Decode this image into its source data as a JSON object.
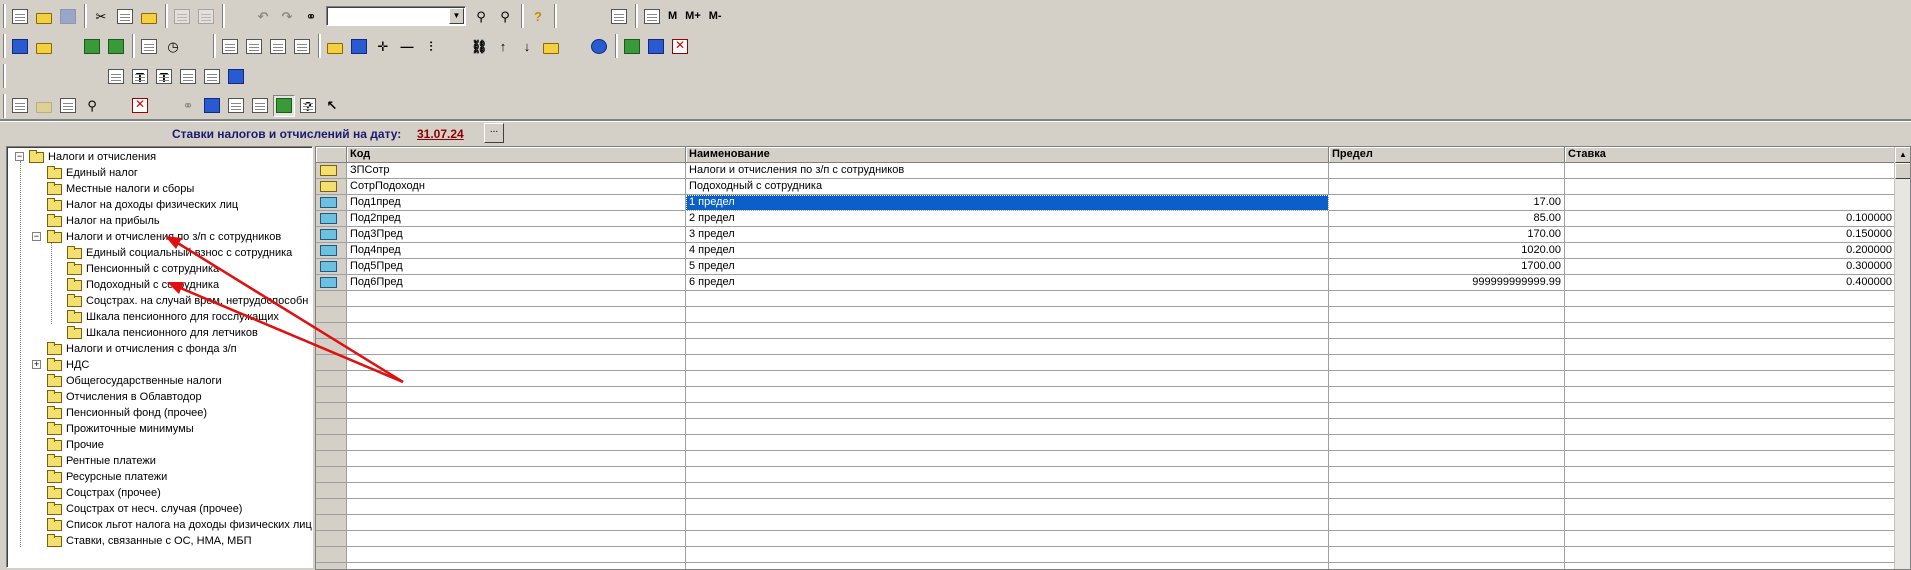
{
  "toolbar1": {
    "combo_value": "",
    "memory_labels": [
      "M",
      "M+",
      "M-"
    ]
  },
  "date_bar": {
    "label": "Ставки налогов и отчислений на дату:",
    "date": "31.07.24",
    "button": "..."
  },
  "tree": {
    "items": [
      {
        "label": "Налоги и отчисления"
      },
      {
        "label": "Единый налог"
      },
      {
        "label": "Местные налоги и сборы"
      },
      {
        "label": "Налог на доходы физических лиц"
      },
      {
        "label": "Налог на прибыль"
      },
      {
        "label": "Налоги и отчисления по з/п с сотрудников"
      },
      {
        "label": "Единый социальный взнос с сотрудника"
      },
      {
        "label": "Пенсионный с сотрудника"
      },
      {
        "label": "Подоходный с сотрудника"
      },
      {
        "label": "Соцстрах. на случай врем. нетрудоспособн"
      },
      {
        "label": "Шкала пенсионного для госслужащих"
      },
      {
        "label": "Шкала пенсионного для летчиков"
      },
      {
        "label": "Налоги и отчисления с фонда з/п"
      },
      {
        "label": "НДС"
      },
      {
        "label": "Общегосударственные налоги"
      },
      {
        "label": "Отчисления в Облавтодор"
      },
      {
        "label": "Пенсионный фонд (прочее)"
      },
      {
        "label": "Прожиточные минимумы"
      },
      {
        "label": "Прочие"
      },
      {
        "label": "Рентные платежи"
      },
      {
        "label": "Ресурсные платежи"
      },
      {
        "label": "Соцстрах (прочее)"
      },
      {
        "label": "Соцстрах от несч. случая (прочее)"
      },
      {
        "label": "Список льгот налога на доходы физических лиц"
      },
      {
        "label": "Ставки, связанные с ОС, НМА, МБП"
      }
    ]
  },
  "table": {
    "columns": [
      "Код",
      "Наименование",
      "Предел",
      "Ставка"
    ],
    "rows": [
      {
        "code": "ЗПСотр",
        "name": "Налоги и отчисления по з/п с сотрудников",
        "limit": "",
        "rate": "",
        "folder": true
      },
      {
        "code": "СотрПодоходн",
        "name": "Подоходный с сотрудника",
        "limit": "",
        "rate": "",
        "folder": true
      },
      {
        "code": "Под1пред",
        "name": "1 предел",
        "limit": "17.00",
        "rate": "",
        "folder": false
      },
      {
        "code": "Под2пред",
        "name": "2 предел",
        "limit": "85.00",
        "rate": "0.100000",
        "folder": false
      },
      {
        "code": "Под3Пред",
        "name": "3 предел",
        "limit": "170.00",
        "rate": "0.150000",
        "folder": false
      },
      {
        "code": "Под4пред",
        "name": "4 предел",
        "limit": "1020.00",
        "rate": "0.200000",
        "folder": false
      },
      {
        "code": "Под5Пред",
        "name": "5 предел",
        "limit": "1700.00",
        "rate": "0.300000",
        "folder": false
      },
      {
        "code": "Под6Пред",
        "name": "6 предел",
        "limit": "999999999999.99",
        "rate": "0.400000",
        "folder": false
      }
    ],
    "selected_row": 2
  }
}
